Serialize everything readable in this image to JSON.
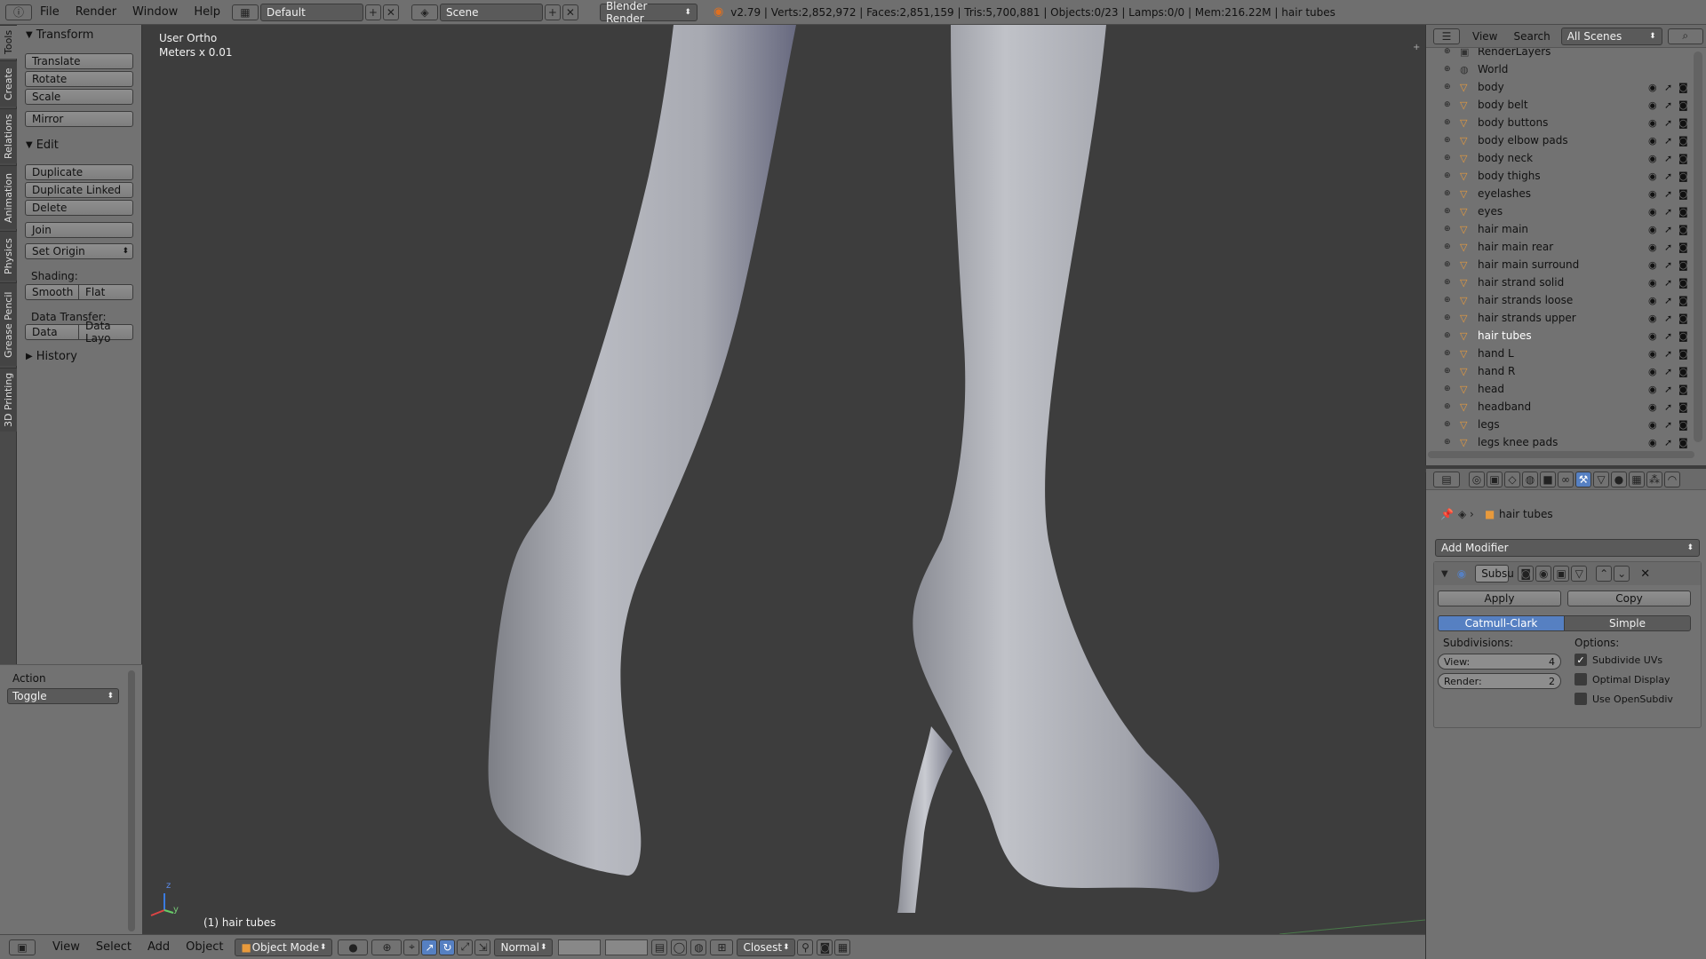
{
  "header": {
    "menus": [
      "File",
      "Render",
      "Window",
      "Help"
    ],
    "layout": "Default",
    "scene": "Scene",
    "engine": "Blender Render",
    "stats": "v2.79 | Verts:2,852,972 | Faces:2,851,159 | Tris:5,700,881 | Objects:0/23 | Lamps:0/0 | Mem:216.22M | hair tubes"
  },
  "left_tabs": [
    "Tools",
    "Create",
    "Relations",
    "Animation",
    "Physics",
    "Grease Pencil",
    "3D Printing"
  ],
  "toolshelf": {
    "transform_title": "Transform",
    "translate": "Translate",
    "rotate": "Rotate",
    "scale": "Scale",
    "mirror": "Mirror",
    "edit_title": "Edit",
    "duplicate": "Duplicate",
    "duplicate_linked": "Duplicate Linked",
    "delete": "Delete",
    "join": "Join",
    "set_origin": "Set Origin",
    "shading_label": "Shading:",
    "smooth": "Smooth",
    "flat": "Flat",
    "data_transfer_label": "Data Transfer:",
    "data": "Data",
    "data_layout": "Data Layo",
    "history_title": "History",
    "action_label": "Action",
    "action_value": "Toggle"
  },
  "viewport": {
    "view_name": "User Ortho",
    "units": "Meters x 0.01",
    "active_object": "(1) hair tubes"
  },
  "outliner": {
    "view": "View",
    "search": "Search",
    "scope": "All Scenes",
    "items": [
      {
        "name": "RenderLayers",
        "type": "renderlayers"
      },
      {
        "name": "World",
        "type": "world"
      },
      {
        "name": "body",
        "type": "mesh"
      },
      {
        "name": "body belt",
        "type": "mesh"
      },
      {
        "name": "body buttons",
        "type": "mesh"
      },
      {
        "name": "body elbow pads",
        "type": "mesh"
      },
      {
        "name": "body neck",
        "type": "mesh"
      },
      {
        "name": "body thighs",
        "type": "mesh"
      },
      {
        "name": "eyelashes",
        "type": "mesh"
      },
      {
        "name": "eyes",
        "type": "mesh"
      },
      {
        "name": "hair main",
        "type": "mesh"
      },
      {
        "name": "hair main rear",
        "type": "mesh"
      },
      {
        "name": "hair main surround",
        "type": "mesh"
      },
      {
        "name": "hair strand solid",
        "type": "mesh"
      },
      {
        "name": "hair strands loose",
        "type": "mesh"
      },
      {
        "name": "hair strands upper",
        "type": "mesh"
      },
      {
        "name": "hair tubes",
        "type": "mesh",
        "selected": true
      },
      {
        "name": "hand L",
        "type": "mesh"
      },
      {
        "name": "hand R",
        "type": "mesh"
      },
      {
        "name": "head",
        "type": "mesh"
      },
      {
        "name": "headband",
        "type": "mesh"
      },
      {
        "name": "legs",
        "type": "mesh"
      },
      {
        "name": "legs knee pads",
        "type": "mesh"
      }
    ]
  },
  "properties": {
    "object_name": "hair tubes",
    "add_modifier": "Add Modifier",
    "modifier_name": "Subsu",
    "apply": "Apply",
    "copy": "Copy",
    "catmull_clark": "Catmull-Clark",
    "simple": "Simple",
    "subdivisions_label": "Subdivisions:",
    "options_label": "Options:",
    "view_label": "View:",
    "view_value": "4",
    "render_label": "Render:",
    "render_value": "2",
    "subdivide_uvs": "Subdivide UVs",
    "optimal_display": "Optimal Display",
    "use_opensubdiv": "Use OpenSubdiv"
  },
  "bottombar": {
    "menus": [
      "View",
      "Select",
      "Add",
      "Object"
    ],
    "mode": "Object Mode",
    "pivot": "Normal",
    "snap": "Closest"
  },
  "colors": {
    "accent_blue": "#5680c2",
    "mesh_orange": "#e89a3c",
    "viewport_bg": "#3d3d3d"
  }
}
